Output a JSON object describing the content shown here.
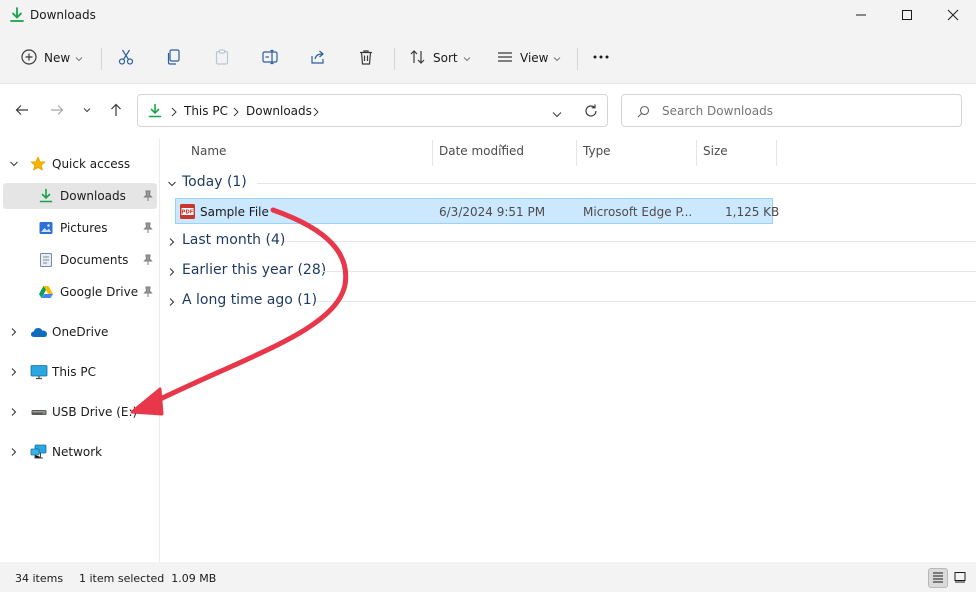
{
  "window": {
    "title": "Downloads"
  },
  "toolbar": {
    "new_label": "New",
    "sort_label": "Sort",
    "view_label": "View"
  },
  "address": {
    "crumbs": [
      "This PC",
      "Downloads"
    ]
  },
  "search": {
    "placeholder": "Search Downloads"
  },
  "sidebar": {
    "items": [
      {
        "label": "Quick access",
        "icon": "star-icon"
      },
      {
        "label": "Downloads",
        "icon": "download-icon"
      },
      {
        "label": "Pictures",
        "icon": "pictures-icon"
      },
      {
        "label": "Documents",
        "icon": "documents-icon"
      },
      {
        "label": "Google Drive (G",
        "icon": "google-drive-icon"
      },
      {
        "label": "OneDrive",
        "icon": "onedrive-icon"
      },
      {
        "label": "This PC",
        "icon": "monitor-icon"
      },
      {
        "label": "USB Drive (E:)",
        "icon": "usb-drive-icon"
      },
      {
        "label": "Network",
        "icon": "network-icon"
      }
    ]
  },
  "columns": {
    "name": "Name",
    "date": "Date modified",
    "type": "Type",
    "size": "Size"
  },
  "groups": [
    {
      "label": "Today (1)"
    },
    {
      "label": "Last month (4)"
    },
    {
      "label": "Earlier this year (28)"
    },
    {
      "label": "A long time ago (1)"
    }
  ],
  "file": {
    "name": "Sample File",
    "date": "6/3/2024 9:51 PM",
    "type": "Microsoft Edge P...",
    "size": "1,125 KB",
    "icon_badge": "PDF"
  },
  "status": {
    "items": "34 items",
    "selected": "1 item selected  1.09 MB"
  },
  "colors": {
    "accent": "#0078d4",
    "selection": "#cce8ff",
    "annotation_arrow": "#e8374a",
    "download_green": "#16a34a"
  }
}
